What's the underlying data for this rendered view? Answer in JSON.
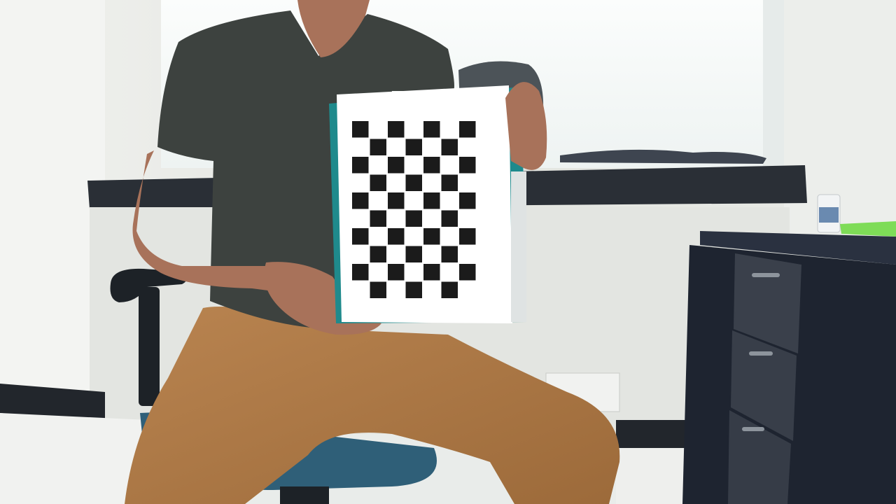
{
  "scene": {
    "kind": "photograph",
    "subject": "person-seated-holding-calibration-target",
    "target": {
      "pattern": "checkerboard",
      "rows": 10,
      "columns": 7,
      "square_color": "#1b1b1b",
      "paper_color": "#ffffff",
      "notebook_cover_color": "#1f8a8c"
    },
    "colors": {
      "wall": "#e4e6e2",
      "window_glow": "#f7f9f8",
      "windowsill": "#2a2f36",
      "baseboard": "#22262c",
      "floor": "#f1f2f0",
      "shirt": "#3d423f",
      "pants": "#b07a45",
      "skin": "#a8725a",
      "chair_seat": "#2f5f78",
      "chair_frame": "#1d2227",
      "desk_top": "#2a3140",
      "desk_drawers": "#3a404b",
      "backpack": "#4c5358",
      "bottle": "#f2f4f5",
      "green_item": "#7edc57"
    }
  }
}
